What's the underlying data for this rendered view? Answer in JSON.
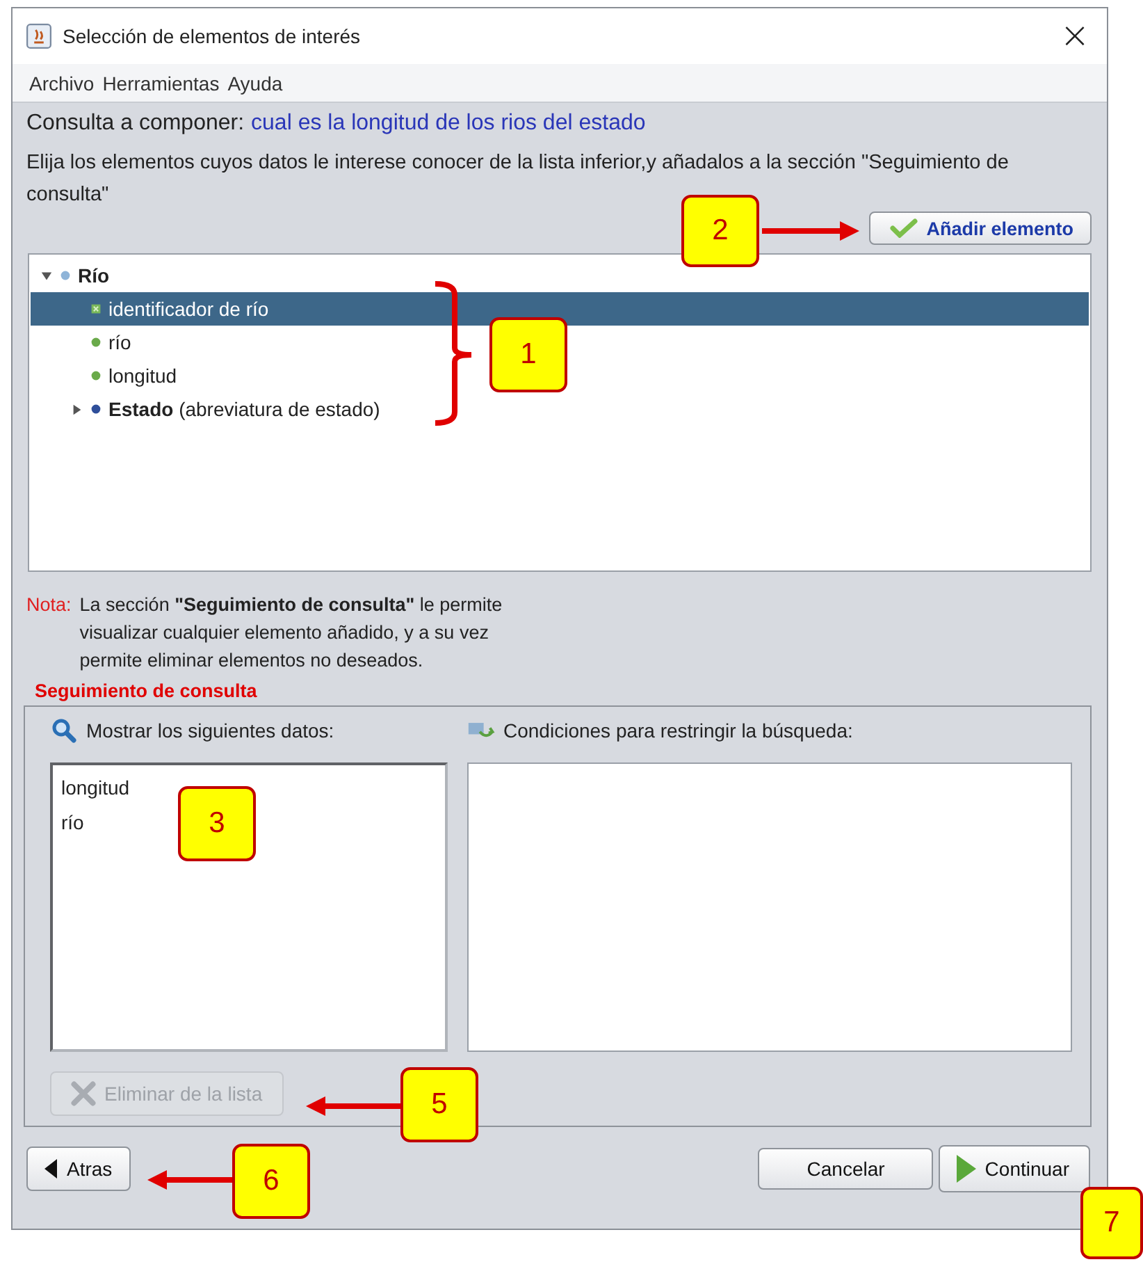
{
  "window": {
    "title": "Selección de elementos de interés",
    "close": "×"
  },
  "menu": [
    "Archivo",
    "Herramientas",
    "Ayuda"
  ],
  "query": {
    "label": "Consulta a componer:",
    "value": "cual es la longitud de los rios del estado"
  },
  "instructions": "Elija los elementos cuyos datos le interese conocer de la lista inferior,y añadalos a la sección \"Seguimiento de consulta\"",
  "add_button": {
    "label": "Añadir elemento"
  },
  "tree": [
    {
      "label": "Río",
      "kind": "entity",
      "color": "#8fb4d8",
      "expanded": true,
      "selected": false,
      "children": [
        {
          "label": "identificador de río",
          "kind": "key",
          "selected": true
        },
        {
          "label": "río",
          "kind": "attribute",
          "color": "#6aaa4a",
          "selected": false
        },
        {
          "label": "longitud",
          "kind": "attribute",
          "color": "#6aaa4a",
          "selected": false
        },
        {
          "label": "**Estado** (abreviatura de estado)",
          "kind": "entity",
          "color": "#2f4f9a",
          "expanded": false,
          "selected": false
        }
      ]
    }
  ],
  "note": {
    "label": "Nota:",
    "text": "La sección **\"Seguimiento de consulta\"** le permite visualizar cualquier elemento añadido, y a su vez permite eliminar elementos no deseados."
  },
  "tracking": {
    "title": "Seguimiento de consulta",
    "show_label": "Mostrar los siguientes datos:",
    "show_items": [
      "longitud",
      "río"
    ],
    "conditions_label": "Condiciones para restringir la búsqueda:",
    "remove_button": {
      "label": "Eliminar de la lista",
      "disabled": true
    }
  },
  "buttons": {
    "back": "Atras",
    "cancel": "Cancelar",
    "continue": "Continuar"
  },
  "callouts": [
    {
      "label": "1"
    },
    {
      "label": "2"
    },
    {
      "label": "3"
    },
    {
      "label": "5"
    },
    {
      "label": "6"
    },
    {
      "label": "7"
    }
  ]
}
